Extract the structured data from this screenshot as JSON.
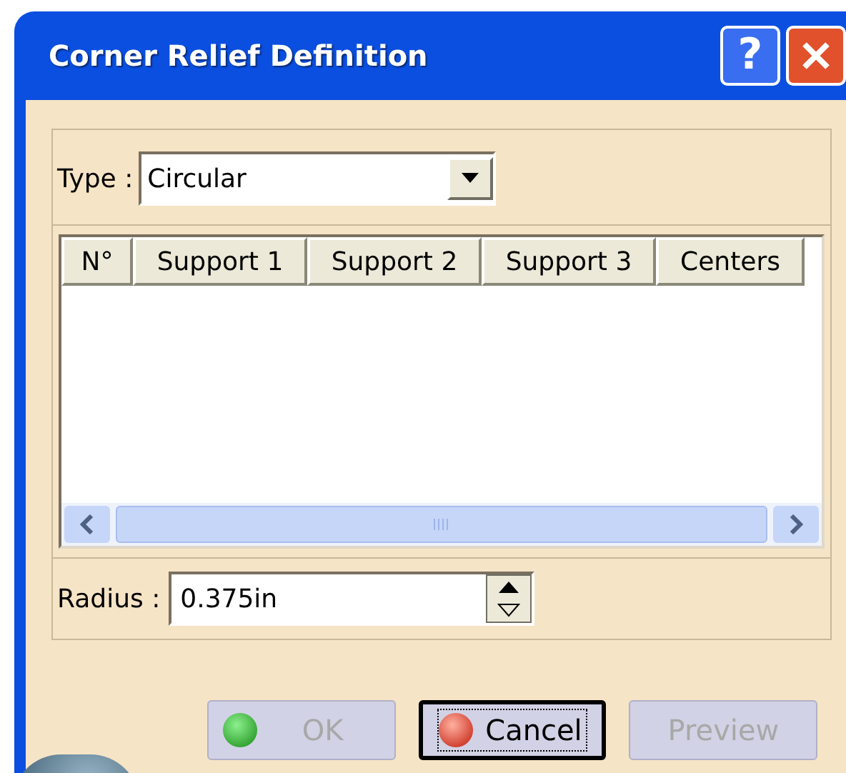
{
  "window": {
    "title": "Corner Relief Definition",
    "title_buttons": [
      {
        "kind": "help",
        "label": "?"
      },
      {
        "kind": "close"
      }
    ]
  },
  "type_field": {
    "label": "Type :",
    "value": "Circular"
  },
  "table": {
    "columns": [
      "N°",
      "Support 1",
      "Support 2",
      "Support 3",
      "Centers"
    ]
  },
  "radius_field": {
    "label": "Radius :",
    "value": "0.375in"
  },
  "buttons": [
    {
      "kind": "ok",
      "label": "OK",
      "disabled": true,
      "focused": false
    },
    {
      "kind": "cancel",
      "label": "Cancel",
      "disabled": false,
      "focused": true
    },
    {
      "kind": "preview",
      "label": "Preview",
      "disabled": true,
      "focused": false
    }
  ]
}
